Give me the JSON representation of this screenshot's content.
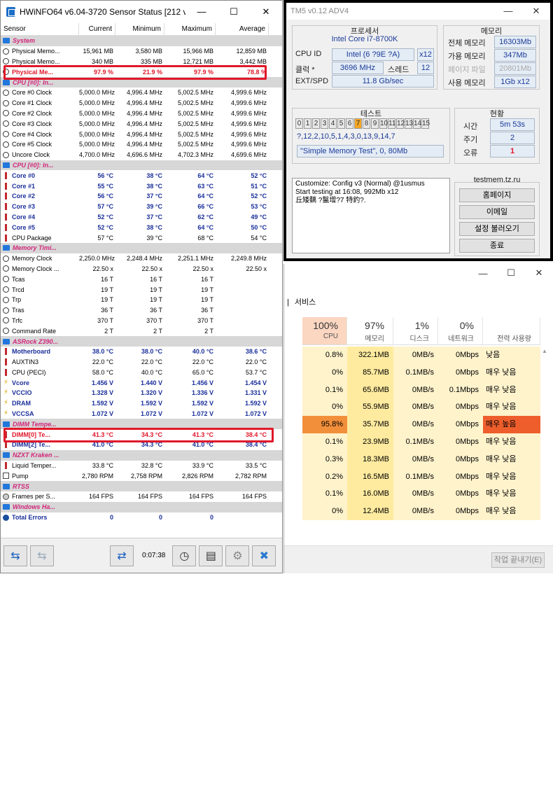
{
  "hwinfo": {
    "title": "HWiNFO64 v6.04-3720 Sensor Status [212 values h...",
    "columns": [
      "Sensor",
      "Current",
      "Minimum",
      "Maximum",
      "Average"
    ],
    "rows": [
      {
        "type": "group",
        "icon": "grp",
        "name": "System"
      },
      {
        "type": "item",
        "icon": "clock",
        "name": "Physical Memo...",
        "v": [
          "15,961 MB",
          "3,580 MB",
          "15,966 MB",
          "12,859 MB"
        ]
      },
      {
        "type": "item",
        "icon": "clock",
        "name": "Physical Memo...",
        "v": [
          "340 MB",
          "335 MB",
          "12,721 MB",
          "3,442 MB"
        ]
      },
      {
        "type": "hilite",
        "icon": "clock",
        "name": "Physical Me...",
        "v": [
          "97.9 %",
          "21.9 %",
          "97.9 %",
          "78.8 %"
        ]
      },
      {
        "type": "group",
        "icon": "grp",
        "name": "CPU [#0]: In..."
      },
      {
        "type": "item",
        "icon": "clock",
        "name": "Core #0 Clock",
        "v": [
          "5,000.0 MHz",
          "4,996.4 MHz",
          "5,002.5 MHz",
          "4,999.6 MHz"
        ]
      },
      {
        "type": "item",
        "icon": "clock",
        "name": "Core #1 Clock",
        "v": [
          "5,000.0 MHz",
          "4,996.4 MHz",
          "5,002.5 MHz",
          "4,999.6 MHz"
        ]
      },
      {
        "type": "item",
        "icon": "clock",
        "name": "Core #2 Clock",
        "v": [
          "5,000.0 MHz",
          "4,996.4 MHz",
          "5,002.5 MHz",
          "4,999.6 MHz"
        ]
      },
      {
        "type": "item",
        "icon": "clock",
        "name": "Core #3 Clock",
        "v": [
          "5,000.0 MHz",
          "4,996.4 MHz",
          "5,002.5 MHz",
          "4,999.6 MHz"
        ]
      },
      {
        "type": "item",
        "icon": "clock",
        "name": "Core #4 Clock",
        "v": [
          "5,000.0 MHz",
          "4,996.4 MHz",
          "5,002.5 MHz",
          "4,999.6 MHz"
        ]
      },
      {
        "type": "item",
        "icon": "clock",
        "name": "Core #5 Clock",
        "v": [
          "5,000.0 MHz",
          "4,996.4 MHz",
          "5,002.5 MHz",
          "4,999.6 MHz"
        ]
      },
      {
        "type": "item",
        "icon": "clock",
        "name": "Uncore Clock",
        "v": [
          "4,700.0 MHz",
          "4,696.6 MHz",
          "4,702.3 MHz",
          "4,699.6 MHz"
        ]
      },
      {
        "type": "group",
        "icon": "grp",
        "name": "CPU [#0]: In..."
      },
      {
        "type": "bold",
        "icon": "therm",
        "name": "Core #0",
        "v": [
          "56 °C",
          "38 °C",
          "64 °C",
          "52 °C"
        ]
      },
      {
        "type": "bold",
        "icon": "therm",
        "name": "Core #1",
        "v": [
          "55 °C",
          "38 °C",
          "63 °C",
          "51 °C"
        ]
      },
      {
        "type": "bold",
        "icon": "therm",
        "name": "Core #2",
        "v": [
          "56 °C",
          "37 °C",
          "64 °C",
          "52 °C"
        ]
      },
      {
        "type": "bold",
        "icon": "therm",
        "name": "Core #3",
        "v": [
          "57 °C",
          "39 °C",
          "66 °C",
          "53 °C"
        ]
      },
      {
        "type": "bold",
        "icon": "therm",
        "name": "Core #4",
        "v": [
          "52 °C",
          "37 °C",
          "62 °C",
          "49 °C"
        ]
      },
      {
        "type": "bold",
        "icon": "therm",
        "name": "Core #5",
        "v": [
          "52 °C",
          "38 °C",
          "64 °C",
          "50 °C"
        ]
      },
      {
        "type": "item",
        "icon": "therm",
        "name": "CPU Package",
        "v": [
          "57 °C",
          "39 °C",
          "68 °C",
          "54 °C"
        ]
      },
      {
        "type": "group",
        "icon": "grp",
        "name": "Memory Timi..."
      },
      {
        "type": "item",
        "icon": "clock",
        "name": "Memory Clock",
        "v": [
          "2,250.0 MHz",
          "2,248.4 MHz",
          "2,251.1 MHz",
          "2,249.8 MHz"
        ]
      },
      {
        "type": "item",
        "icon": "clock",
        "name": "Memory Clock ...",
        "v": [
          "22.50 x",
          "22.50 x",
          "22.50 x",
          "22.50 x"
        ]
      },
      {
        "type": "item",
        "icon": "clock",
        "name": "Tcas",
        "v": [
          "16 T",
          "16 T",
          "16 T",
          ""
        ]
      },
      {
        "type": "item",
        "icon": "clock",
        "name": "Trcd",
        "v": [
          "19 T",
          "19 T",
          "19 T",
          ""
        ]
      },
      {
        "type": "item",
        "icon": "clock",
        "name": "Trp",
        "v": [
          "19 T",
          "19 T",
          "19 T",
          ""
        ]
      },
      {
        "type": "item",
        "icon": "clock",
        "name": "Tras",
        "v": [
          "36 T",
          "36 T",
          "36 T",
          ""
        ]
      },
      {
        "type": "item",
        "icon": "clock",
        "name": "Trfc",
        "v": [
          "370 T",
          "370 T",
          "370 T",
          ""
        ]
      },
      {
        "type": "item",
        "icon": "clock",
        "name": "Command Rate",
        "v": [
          "2 T",
          "2 T",
          "2 T",
          ""
        ]
      },
      {
        "type": "group",
        "icon": "grp",
        "name": "ASRock Z390..."
      },
      {
        "type": "bold",
        "icon": "therm",
        "name": "Motherboard",
        "v": [
          "38.0 °C",
          "38.0 °C",
          "40.0 °C",
          "38.6 °C"
        ]
      },
      {
        "type": "item",
        "icon": "therm",
        "name": "AUXTIN3",
        "v": [
          "22.0 °C",
          "22.0 °C",
          "22.0 °C",
          "22.0 °C"
        ]
      },
      {
        "type": "item",
        "icon": "therm",
        "name": "CPU (PECI)",
        "v": [
          "58.0 °C",
          "40.0 °C",
          "65.0 °C",
          "53.7 °C"
        ]
      },
      {
        "type": "bold",
        "icon": "bolt",
        "name": "Vcore",
        "v": [
          "1.456 V",
          "1.440 V",
          "1.456 V",
          "1.454 V"
        ]
      },
      {
        "type": "bold",
        "icon": "bolt",
        "name": "VCCIO",
        "v": [
          "1.328 V",
          "1.320 V",
          "1.336 V",
          "1.331 V"
        ]
      },
      {
        "type": "bold",
        "icon": "bolt",
        "name": "DRAM",
        "v": [
          "1.592 V",
          "1.592 V",
          "1.592 V",
          "1.592 V"
        ]
      },
      {
        "type": "bold",
        "icon": "bolt",
        "name": "VCCSA",
        "v": [
          "1.072 V",
          "1.072 V",
          "1.072 V",
          "1.072 V"
        ]
      },
      {
        "type": "group",
        "icon": "grp",
        "name": "DIMM Tempe..."
      },
      {
        "type": "hilite",
        "icon": "therm",
        "name": "DIMM[0] Te...",
        "v": [
          "41.3 °C",
          "34.3 °C",
          "41.3 °C",
          "38.4 °C"
        ]
      },
      {
        "type": "bold",
        "icon": "therm",
        "name": "DIMM[2] Te...",
        "v": [
          "41.0 °C",
          "34.3 °C",
          "41.0 °C",
          "38.4 °C"
        ]
      },
      {
        "type": "group",
        "icon": "grp",
        "name": "NZXT Kraken ..."
      },
      {
        "type": "item",
        "icon": "therm",
        "name": "Liquid Temper...",
        "v": [
          "33.8 °C",
          "32.8 °C",
          "33.9 °C",
          "33.5 °C"
        ]
      },
      {
        "type": "item",
        "icon": "fan",
        "name": "Pump",
        "v": [
          "2,780 RPM",
          "2,758 RPM",
          "2,826 RPM",
          "2,782 RPM"
        ]
      },
      {
        "type": "group",
        "icon": "grp",
        "name": "RTSS"
      },
      {
        "type": "item",
        "icon": "frames",
        "name": "Frames per S...",
        "v": [
          "164 FPS",
          "164 FPS",
          "164 FPS",
          "164 FPS"
        ]
      },
      {
        "type": "group",
        "icon": "grp",
        "name": "Windows Ha..."
      },
      {
        "type": "bold",
        "icon": "err",
        "name": "Total Errors",
        "v": [
          "0",
          "0",
          "0",
          ""
        ]
      }
    ],
    "timer": "0:07:38"
  },
  "tm5": {
    "title": "TM5 v0.12 ADV4",
    "processor_title": "프로세서",
    "cpu_name": "Intel Core i7-8700K",
    "cpu_id_label": "CPU ID",
    "cpu_id_value": "Intel (6 ?9E ?A)",
    "cpu_threads": "x12",
    "clock_label": "클럭 *",
    "clock_value": "3696 MHz",
    "threads_label": "스레드",
    "threads_value": "12",
    "ext_label": "EXT/SPD",
    "ext_value": "11.8 Gb/sec",
    "memory_title": "메모리",
    "mem_total_label": "전체 메모리",
    "mem_total_value": "16303Mb",
    "mem_avail_label": "가용 메모리",
    "mem_avail_value": "347Mb",
    "pagefile_label": "페이지 파일",
    "pagefile_value": "20801Mb",
    "mem_used_label": "사용 메모리",
    "mem_used_value": "1Gb x12",
    "test_title": "테스트",
    "test_digits": [
      "0",
      "1",
      "2",
      "3",
      "4",
      "5",
      "6",
      "7",
      "8",
      "9",
      "10",
      "11",
      "12",
      "13",
      "14",
      "15"
    ],
    "test_active": "7",
    "test_sequence": "?,12,2,10,5,1,4,3,0,13,9,14,7",
    "test_name": "\"Simple Memory Test\", 0, 80Mb",
    "status_title": "현황",
    "time_label": "시간",
    "time_value": "5m 53s",
    "cycle_label": "주기",
    "cycle_value": "2",
    "error_label": "오류",
    "error_value": "1",
    "log_lines": [
      "Customize: Config v3 (Normal) @1usmus",
      "Start testing at 16:08, 992Mb x12",
      "丘矮黐 ?鬣增?7 特釣?."
    ],
    "site": "testmem.tz.ru",
    "btn_home": "홈페이지",
    "btn_email": "이메일",
    "btn_load": "설정 불러오기",
    "btn_exit": "종료"
  },
  "taskmgr": {
    "tab_services": "서비스",
    "tab_prefix": "|",
    "cpu_pct": "100%",
    "cpu_label": "CPU",
    "mem_pct": "97%",
    "mem_label": "메모리",
    "disk_pct": "1%",
    "disk_label": "디스크",
    "net_pct": "0%",
    "net_label": "네트워크",
    "power_label": "전력 사용량",
    "rows": [
      {
        "cpu": "0.8%",
        "mem": "322.1MB",
        "disk": "0MB/s",
        "net": "0Mbps",
        "power": "낮음"
      },
      {
        "cpu": "0%",
        "mem": "85.7MB",
        "disk": "0.1MB/s",
        "net": "0Mbps",
        "power": "매우 낮음"
      },
      {
        "cpu": "0.1%",
        "mem": "65.6MB",
        "disk": "0MB/s",
        "net": "0.1Mbps",
        "power": "매우 낮음"
      },
      {
        "cpu": "0%",
        "mem": "55.9MB",
        "disk": "0MB/s",
        "net": "0Mbps",
        "power": "매우 낮음"
      },
      {
        "cpu": "95.8%",
        "mem": "35.7MB",
        "disk": "0MB/s",
        "net": "0Mbps",
        "power": "매우 높음"
      },
      {
        "cpu": "0.1%",
        "mem": "23.9MB",
        "disk": "0.1MB/s",
        "net": "0Mbps",
        "power": "매우 낮음"
      },
      {
        "cpu": "0.3%",
        "mem": "18.3MB",
        "disk": "0MB/s",
        "net": "0Mbps",
        "power": "매우 낮음"
      },
      {
        "cpu": "0.2%",
        "mem": "16.5MB",
        "disk": "0.1MB/s",
        "net": "0Mbps",
        "power": "매우 낮음"
      },
      {
        "cpu": "0.1%",
        "mem": "16.0MB",
        "disk": "0MB/s",
        "net": "0Mbps",
        "power": "매우 낮음"
      },
      {
        "cpu": "0%",
        "mem": "12.4MB",
        "disk": "0MB/s",
        "net": "0Mbps",
        "power": "매우 낮음"
      }
    ],
    "end_task": "작업 끝내기(E)"
  },
  "colors": {
    "highlight_red": "#e0182a",
    "group_pink": "#d3257a",
    "bold_blue": "#1a2f9a",
    "tm_active": "#f5a623"
  }
}
